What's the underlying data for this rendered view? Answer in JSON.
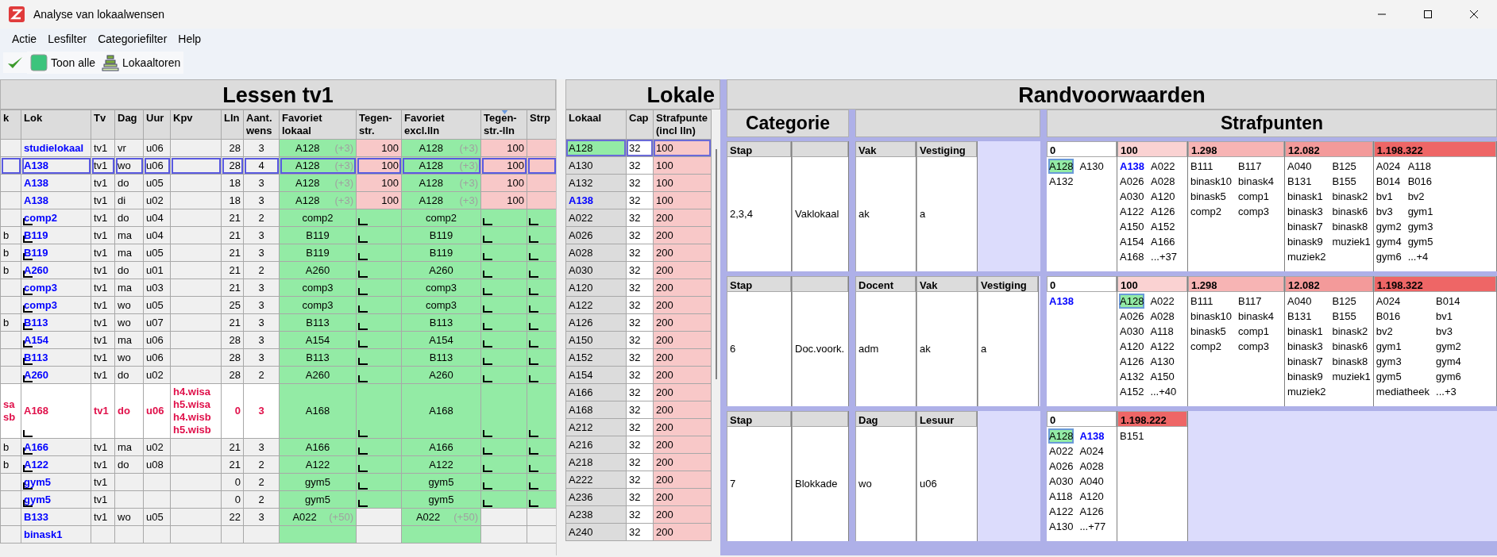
{
  "window": {
    "title": "Analyse van lokaalwensen"
  },
  "menu": [
    "Actie",
    "Lesfilter",
    "Categoriefilter",
    "Help"
  ],
  "toolbar": [
    {
      "kind": "check"
    },
    {
      "kind": "color",
      "label": "Toon alle"
    },
    {
      "kind": "tower",
      "label": "Lokaaltoren"
    }
  ],
  "lessons": {
    "title": "Lessen tv1",
    "columns": [
      {
        "label": "k",
        "sorted": false
      },
      {
        "label": "Lok",
        "sorted": false
      },
      {
        "label": "Tv",
        "sorted": false
      },
      {
        "label": "Dag",
        "sorted": false
      },
      {
        "label": "Uur",
        "sorted": false
      },
      {
        "label": "Kpv",
        "sorted": false
      },
      {
        "label": "Lln",
        "sorted": false
      },
      {
        "label": "Aant.\nwens",
        "sorted": false
      },
      {
        "label": "Favoriet\nlokaal",
        "sorted": false
      },
      {
        "label": "Tegen-\nstr.",
        "sorted": false
      },
      {
        "label": "Favoriet\nexcl.lln",
        "sorted": false
      },
      {
        "label": "Tegen-\nstr.-lln",
        "sorted": true
      },
      {
        "label": "Strp",
        "sorted": false
      }
    ],
    "rows": [
      {
        "lok": "studielokaal",
        "tv": "tv1",
        "dag": "vr",
        "uur": "u06",
        "lln": "28",
        "aant": "3",
        "fav": "A128",
        "fav_hint": "(+3)",
        "teg": "100",
        "fav_excl": "A128",
        "fav_excl_hint": "(+3)",
        "teg_lln": "100",
        "kind": "penalty",
        "fixed": false,
        "selected": false
      },
      {
        "lok": "A138",
        "tv": "tv1",
        "dag": "wo",
        "uur": "u06",
        "lln": "28",
        "aant": "4",
        "fav": "A128",
        "fav_hint": "(+3)",
        "teg": "100",
        "fav_excl": "A128",
        "fav_excl_hint": "(+3)",
        "teg_lln": "100",
        "kind": "penalty",
        "fixed": false,
        "selected": true
      },
      {
        "lok": "A138",
        "tv": "tv1",
        "dag": "do",
        "uur": "u05",
        "lln": "18",
        "aant": "3",
        "fav": "A128",
        "fav_hint": "(+3)",
        "teg": "100",
        "fav_excl": "A128",
        "fav_excl_hint": "(+3)",
        "teg_lln": "100",
        "kind": "penalty",
        "fixed": false,
        "selected": false
      },
      {
        "lok": "A138",
        "tv": "tv1",
        "dag": "di",
        "uur": "u02",
        "lln": "18",
        "aant": "3",
        "fav": "A128",
        "fav_hint": "(+3)",
        "teg": "100",
        "fav_excl": "A128",
        "fav_excl_hint": "(+3)",
        "teg_lln": "100",
        "kind": "penalty",
        "fixed": false,
        "selected": false
      },
      {
        "lok": "comp2",
        "tv": "tv1",
        "dag": "do",
        "uur": "u04",
        "lln": "21",
        "aant": "2",
        "fav": "comp2",
        "fav_excl": "comp2",
        "kind": "match",
        "fixed": true,
        "selected": false
      },
      {
        "k": "b",
        "lok": "B119",
        "tv": "tv1",
        "dag": "ma",
        "uur": "u04",
        "lln": "21",
        "aant": "3",
        "fav": "B119",
        "fav_excl": "B119",
        "kind": "match",
        "fixed": true,
        "selected": false
      },
      {
        "k": "b",
        "lok": "B119",
        "tv": "tv1",
        "dag": "ma",
        "uur": "u05",
        "lln": "21",
        "aant": "3",
        "fav": "B119",
        "fav_excl": "B119",
        "kind": "match",
        "fixed": true,
        "selected": false
      },
      {
        "k": "b",
        "lok": "A260",
        "tv": "tv1",
        "dag": "do",
        "uur": "u01",
        "lln": "21",
        "aant": "2",
        "fav": "A260",
        "fav_excl": "A260",
        "kind": "match",
        "fixed": true,
        "selected": false
      },
      {
        "lok": "comp3",
        "tv": "tv1",
        "dag": "ma",
        "uur": "u03",
        "lln": "21",
        "aant": "3",
        "fav": "comp3",
        "fav_excl": "comp3",
        "kind": "match",
        "fixed": true,
        "selected": false
      },
      {
        "lok": "comp3",
        "tv": "tv1",
        "dag": "wo",
        "uur": "u05",
        "lln": "25",
        "aant": "3",
        "fav": "comp3",
        "fav_excl": "comp3",
        "kind": "match",
        "fixed": true,
        "selected": false
      },
      {
        "k": "b",
        "lok": "B113",
        "tv": "tv1",
        "dag": "wo",
        "uur": "u07",
        "lln": "21",
        "aant": "3",
        "fav": "B113",
        "fav_excl": "B113",
        "kind": "match",
        "fixed": true,
        "selected": false
      },
      {
        "lok": "A154",
        "tv": "tv1",
        "dag": "ma",
        "uur": "u06",
        "lln": "28",
        "aant": "3",
        "fav": "A154",
        "fav_excl": "A154",
        "kind": "match",
        "fixed": true,
        "selected": false
      },
      {
        "lok": "B113",
        "tv": "tv1",
        "dag": "wo",
        "uur": "u06",
        "lln": "28",
        "aant": "3",
        "fav": "B113",
        "fav_excl": "B113",
        "kind": "match",
        "fixed": true,
        "selected": false
      },
      {
        "lok": "A260",
        "tv": "tv1",
        "dag": "do",
        "uur": "u02",
        "lln": "28",
        "aant": "2",
        "fav": "A260",
        "fav_excl": "A260",
        "kind": "match",
        "fixed": true,
        "selected": false
      },
      {
        "k": "sa sb",
        "lok": "A168",
        "tv": "tv1",
        "dag": "do",
        "uur": "u06",
        "kpv": "h4.wisa h5.wisa h4.wisb h5.wisb",
        "lln": "0",
        "aant": "3",
        "fav": "A168",
        "fav_excl": "A168",
        "kind": "conflict",
        "fixed": true,
        "selected": false
      },
      {
        "k": "b",
        "lok": "A166",
        "tv": "tv1",
        "dag": "ma",
        "uur": "u02",
        "lln": "21",
        "aant": "3",
        "fav": "A166",
        "fav_excl": "A166",
        "kind": "match",
        "fixed": true,
        "selected": false
      },
      {
        "k": "b",
        "lok": "A122",
        "tv": "tv1",
        "dag": "do",
        "uur": "u08",
        "lln": "21",
        "aant": "2",
        "fav": "A122",
        "fav_excl": "A122",
        "kind": "match",
        "fixed": true,
        "selected": false
      },
      {
        "lok": "gym5",
        "tv": "tv1",
        "lln": "0",
        "aant": "2",
        "fav": "gym5",
        "fav_excl": "gym5",
        "kind": "match",
        "fixed": true,
        "selected": false
      },
      {
        "lok": "gym5",
        "tv": "tv1",
        "lln": "0",
        "aant": "2",
        "fav": "gym5",
        "fav_excl": "gym5",
        "kind": "match",
        "fixed": true,
        "selected": false
      },
      {
        "lok": "B133",
        "tv": "tv1",
        "dag": "wo",
        "uur": "u05",
        "lln": "22",
        "aant": "3",
        "fav": "A022",
        "fav_hint": "(+50)",
        "fav_excl": "A022",
        "fav_excl_hint": "(+50)",
        "kind": "open",
        "fixed": false,
        "selected": false
      },
      {
        "lok": "binask1",
        "kind": "open",
        "fixed": false,
        "selected": false
      }
    ]
  },
  "lokalen": {
    "title": "Lokale",
    "columns": [
      "Lokaal",
      "Cap",
      "Strafpunte\n(incl lln)"
    ],
    "rows": [
      {
        "lokaal": "A128",
        "cap": "32",
        "straf": "100",
        "kind": "selected"
      },
      {
        "lokaal": "A130",
        "cap": "32",
        "straf": "100",
        "kind": "plain"
      },
      {
        "lokaal": "A132",
        "cap": "32",
        "straf": "100",
        "kind": "plain"
      },
      {
        "lokaal": "A138",
        "cap": "32",
        "straf": "100",
        "kind": "current"
      },
      {
        "lokaal": "A022",
        "cap": "32",
        "straf": "200",
        "kind": "plain"
      },
      {
        "lokaal": "A026",
        "cap": "32",
        "straf": "200",
        "kind": "plain"
      },
      {
        "lokaal": "A028",
        "cap": "32",
        "straf": "200",
        "kind": "plain"
      },
      {
        "lokaal": "A030",
        "cap": "32",
        "straf": "200",
        "kind": "plain"
      },
      {
        "lokaal": "A120",
        "cap": "32",
        "straf": "200",
        "kind": "plain"
      },
      {
        "lokaal": "A122",
        "cap": "32",
        "straf": "200",
        "kind": "plain"
      },
      {
        "lokaal": "A126",
        "cap": "32",
        "straf": "200",
        "kind": "plain"
      },
      {
        "lokaal": "A150",
        "cap": "32",
        "straf": "200",
        "kind": "plain"
      },
      {
        "lokaal": "A152",
        "cap": "32",
        "straf": "200",
        "kind": "plain"
      },
      {
        "lokaal": "A154",
        "cap": "32",
        "straf": "200",
        "kind": "plain"
      },
      {
        "lokaal": "A166",
        "cap": "32",
        "straf": "200",
        "kind": "plain"
      },
      {
        "lokaal": "A168",
        "cap": "32",
        "straf": "200",
        "kind": "plain"
      },
      {
        "lokaal": "A212",
        "cap": "32",
        "straf": "200",
        "kind": "plain"
      },
      {
        "lokaal": "A216",
        "cap": "32",
        "straf": "200",
        "kind": "plain"
      },
      {
        "lokaal": "A218",
        "cap": "32",
        "straf": "200",
        "kind": "plain"
      },
      {
        "lokaal": "A222",
        "cap": "32",
        "straf": "200",
        "kind": "plain"
      },
      {
        "lokaal": "A236",
        "cap": "32",
        "straf": "200",
        "kind": "plain"
      },
      {
        "lokaal": "A238",
        "cap": "32",
        "straf": "200",
        "kind": "plain"
      },
      {
        "lokaal": "A240",
        "cap": "32",
        "straf": "200",
        "kind": "plain"
      }
    ]
  },
  "randvoorwaarden": {
    "title": "Randvoorwaarden",
    "category_header": "Categorie",
    "penalty_header": "Strafpunten",
    "blocks": [
      {
        "stap_label": "Stap",
        "stap": "2,3,4",
        "category": "Vaklokaal",
        "criteria": [
          {
            "label": "Vak",
            "value": "ak"
          },
          {
            "label": "Vestiging",
            "value": "a"
          }
        ],
        "groups": [
          {
            "points": "0",
            "color": "#ffffff",
            "rooms": [
              {
                "room": "A128",
                "kind": "selected"
              },
              {
                "room": "A130",
                "kind": "plain"
              },
              {
                "room": "A132",
                "kind": "plain"
              }
            ]
          },
          {
            "points": "100",
            "color": "#fad2d2",
            "rooms": [
              {
                "room": "A138",
                "kind": "current"
              },
              {
                "room": "A022",
                "kind": "plain"
              },
              {
                "room": "A026",
                "kind": "plain"
              },
              {
                "room": "A028",
                "kind": "plain"
              },
              {
                "room": "A030",
                "kind": "plain"
              },
              {
                "room": "A120",
                "kind": "plain"
              },
              {
                "room": "A122",
                "kind": "plain"
              },
              {
                "room": "A126",
                "kind": "plain"
              },
              {
                "room": "A150",
                "kind": "plain"
              },
              {
                "room": "A152",
                "kind": "plain"
              },
              {
                "room": "A154",
                "kind": "plain"
              },
              {
                "room": "A166",
                "kind": "plain"
              },
              {
                "room": "A168",
                "kind": "plain"
              },
              {
                "room": "...+37",
                "kind": "plain"
              }
            ]
          },
          {
            "points": "1.298",
            "color": "#f7b4b4",
            "rooms": [
              {
                "room": "B111",
                "kind": "plain"
              },
              {
                "room": "B117",
                "kind": "plain"
              },
              {
                "room": "binask10",
                "kind": "plain"
              },
              {
                "room": "binask4",
                "kind": "plain"
              },
              {
                "room": "binask5",
                "kind": "plain"
              },
              {
                "room": "comp1",
                "kind": "plain"
              },
              {
                "room": "comp2",
                "kind": "plain"
              },
              {
                "room": "comp3",
                "kind": "plain"
              }
            ]
          },
          {
            "points": "12.082",
            "color": "#f39a9a",
            "rooms": [
              {
                "room": "A040",
                "kind": "plain"
              },
              {
                "room": "B125",
                "kind": "plain"
              },
              {
                "room": "B131",
                "kind": "plain"
              },
              {
                "room": "B155",
                "kind": "plain"
              },
              {
                "room": "binask1",
                "kind": "plain"
              },
              {
                "room": "binask2",
                "kind": "plain"
              },
              {
                "room": "binask3",
                "kind": "plain"
              },
              {
                "room": "binask6",
                "kind": "plain"
              },
              {
                "room": "binask7",
                "kind": "plain"
              },
              {
                "room": "binask8",
                "kind": "plain"
              },
              {
                "room": "binask9",
                "kind": "plain"
              },
              {
                "room": "muziek1",
                "kind": "plain"
              },
              {
                "room": "muziek2",
                "kind": "plain"
              }
            ]
          },
          {
            "points": "1.198.322",
            "color": "#ee6666",
            "rooms": [
              {
                "room": "A024",
                "kind": "plain"
              },
              {
                "room": "A118",
                "kind": "plain"
              },
              {
                "room": "B014",
                "kind": "plain"
              },
              {
                "room": "B016",
                "kind": "plain"
              },
              {
                "room": "bv1",
                "kind": "plain"
              },
              {
                "room": "bv2",
                "kind": "plain"
              },
              {
                "room": "bv3",
                "kind": "plain"
              },
              {
                "room": "gym1",
                "kind": "plain"
              },
              {
                "room": "gym2",
                "kind": "plain"
              },
              {
                "room": "gym3",
                "kind": "plain"
              },
              {
                "room": "gym4",
                "kind": "plain"
              },
              {
                "room": "gym5",
                "kind": "plain"
              },
              {
                "room": "gym6",
                "kind": "plain"
              },
              {
                "room": "...+4",
                "kind": "plain"
              }
            ]
          }
        ]
      },
      {
        "stap_label": "Stap",
        "stap": "6",
        "category": "Doc.voork.",
        "criteria": [
          {
            "label": "Docent",
            "value": "adm"
          },
          {
            "label": "Vak",
            "value": "ak"
          },
          {
            "label": "Vestiging",
            "value": "a"
          }
        ],
        "groups": [
          {
            "points": "0",
            "color": "#ffffff",
            "rooms": [
              {
                "room": "A138",
                "kind": "current"
              }
            ]
          },
          {
            "points": "100",
            "color": "#fad2d2",
            "rooms": [
              {
                "room": "A128",
                "kind": "selected"
              },
              {
                "room": "A022",
                "kind": "plain"
              },
              {
                "room": "A026",
                "kind": "plain"
              },
              {
                "room": "A028",
                "kind": "plain"
              },
              {
                "room": "A030",
                "kind": "plain"
              },
              {
                "room": "A118",
                "kind": "plain"
              },
              {
                "room": "A120",
                "kind": "plain"
              },
              {
                "room": "A122",
                "kind": "plain"
              },
              {
                "room": "A126",
                "kind": "plain"
              },
              {
                "room": "A130",
                "kind": "plain"
              },
              {
                "room": "A132",
                "kind": "plain"
              },
              {
                "room": "A150",
                "kind": "plain"
              },
              {
                "room": "A152",
                "kind": "plain"
              },
              {
                "room": "...+40",
                "kind": "plain"
              }
            ]
          },
          {
            "points": "1.298",
            "color": "#f7b4b4",
            "rooms": [
              {
                "room": "B111",
                "kind": "plain"
              },
              {
                "room": "B117",
                "kind": "plain"
              },
              {
                "room": "binask10",
                "kind": "plain"
              },
              {
                "room": "binask4",
                "kind": "plain"
              },
              {
                "room": "binask5",
                "kind": "plain"
              },
              {
                "room": "comp1",
                "kind": "plain"
              },
              {
                "room": "comp2",
                "kind": "plain"
              },
              {
                "room": "comp3",
                "kind": "plain"
              }
            ]
          },
          {
            "points": "12.082",
            "color": "#f39a9a",
            "rooms": [
              {
                "room": "A040",
                "kind": "plain"
              },
              {
                "room": "B125",
                "kind": "plain"
              },
              {
                "room": "B131",
                "kind": "plain"
              },
              {
                "room": "B155",
                "kind": "plain"
              },
              {
                "room": "binask1",
                "kind": "plain"
              },
              {
                "room": "binask2",
                "kind": "plain"
              },
              {
                "room": "binask3",
                "kind": "plain"
              },
              {
                "room": "binask6",
                "kind": "plain"
              },
              {
                "room": "binask7",
                "kind": "plain"
              },
              {
                "room": "binask8",
                "kind": "plain"
              },
              {
                "room": "binask9",
                "kind": "plain"
              },
              {
                "room": "muziek1",
                "kind": "plain"
              },
              {
                "room": "muziek2",
                "kind": "plain"
              }
            ]
          },
          {
            "points": "1.198.322",
            "color": "#ee6666",
            "rooms": [
              {
                "room": "A024",
                "kind": "plain"
              },
              {
                "room": "B014",
                "kind": "plain"
              },
              {
                "room": "B016",
                "kind": "plain"
              },
              {
                "room": "bv1",
                "kind": "plain"
              },
              {
                "room": "bv2",
                "kind": "plain"
              },
              {
                "room": "bv3",
                "kind": "plain"
              },
              {
                "room": "gym1",
                "kind": "plain"
              },
              {
                "room": "gym2",
                "kind": "plain"
              },
              {
                "room": "gym3",
                "kind": "plain"
              },
              {
                "room": "gym4",
                "kind": "plain"
              },
              {
                "room": "gym5",
                "kind": "plain"
              },
              {
                "room": "gym6",
                "kind": "plain"
              },
              {
                "room": "mediatheek",
                "kind": "plain"
              },
              {
                "room": "...+3",
                "kind": "plain"
              }
            ]
          }
        ]
      },
      {
        "stap_label": "Stap",
        "stap": "7",
        "category": "Blokkade",
        "criteria": [
          {
            "label": "Dag",
            "value": "wo"
          },
          {
            "label": "Lesuur",
            "value": "u06"
          }
        ],
        "groups": [
          {
            "points": "0",
            "color": "#ffffff",
            "rooms": [
              {
                "room": "A128",
                "kind": "selected"
              },
              {
                "room": "A138",
                "kind": "current"
              },
              {
                "room": "A022",
                "kind": "plain"
              },
              {
                "room": "A024",
                "kind": "plain"
              },
              {
                "room": "A026",
                "kind": "plain"
              },
              {
                "room": "A028",
                "kind": "plain"
              },
              {
                "room": "A030",
                "kind": "plain"
              },
              {
                "room": "A040",
                "kind": "plain"
              },
              {
                "room": "A118",
                "kind": "plain"
              },
              {
                "room": "A120",
                "kind": "plain"
              },
              {
                "room": "A122",
                "kind": "plain"
              },
              {
                "room": "A126",
                "kind": "plain"
              },
              {
                "room": "A130",
                "kind": "plain"
              },
              {
                "room": "...+77",
                "kind": "plain"
              }
            ]
          },
          {
            "points": "1.198.222",
            "color": "#ee6666",
            "rooms": [
              {
                "room": "B151",
                "kind": "plain"
              }
            ]
          }
        ]
      }
    ]
  }
}
